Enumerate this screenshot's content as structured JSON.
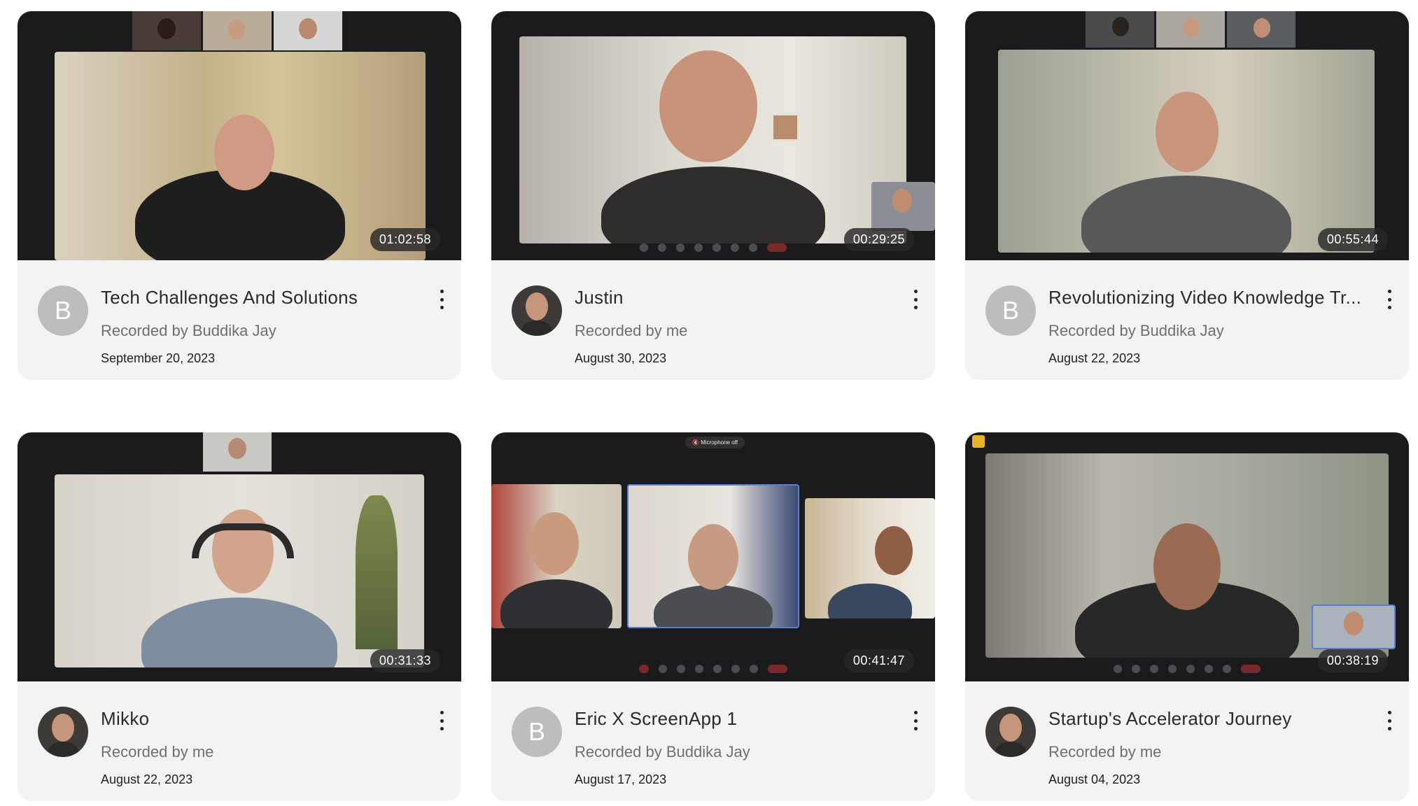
{
  "recordings": [
    {
      "title": "Tech Challenges And Solutions",
      "recorded_by": "Recorded by Buddika Jay",
      "date": "September 20, 2023",
      "duration": "01:02:58",
      "avatar_letter": "B"
    },
    {
      "title": "Justin",
      "recorded_by": "Recorded by me",
      "date": "August 30, 2023",
      "duration": "00:29:25",
      "avatar_letter": ""
    },
    {
      "title": "Revolutionizing Video Knowledge Tr...",
      "recorded_by": "Recorded by Buddika Jay",
      "date": "August 22, 2023",
      "duration": "00:55:44",
      "avatar_letter": "B"
    },
    {
      "title": "Mikko",
      "recorded_by": "Recorded by me",
      "date": "August 22, 2023",
      "duration": "00:31:33",
      "avatar_letter": ""
    },
    {
      "title": "Eric X ScreenApp 1",
      "recorded_by": "Recorded by Buddika Jay",
      "date": "August 17, 2023",
      "duration": "00:41:47",
      "avatar_letter": "B"
    },
    {
      "title": "Startup's Accelerator Journey",
      "recorded_by": "Recorded by me",
      "date": "August 04, 2023",
      "duration": "00:38:19",
      "avatar_letter": ""
    }
  ],
  "thumbnail_overlays": {
    "microphone_off": "Microphone off"
  },
  "colors": {
    "card_background": "#f3f3f3",
    "thumbnail_background": "#1b1b1d",
    "avatar_letter_background": "#bdbdbd",
    "duration_badge": "#282828",
    "end_call_red": "#d83a3a"
  }
}
